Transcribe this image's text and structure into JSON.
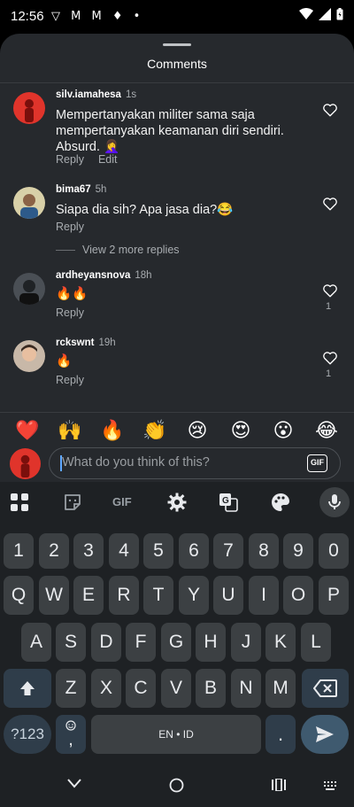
{
  "status_bar": {
    "time": "12:56",
    "notification_icons": "▽ M M ♦ •"
  },
  "sheet": {
    "title": "Comments"
  },
  "comments": [
    {
      "username": "silv.iamahesa",
      "time": "1s",
      "text": "Mempertanyakan militer sama saja mempertanyakan keamanan diri sendiri. Absurd. 🤦‍♀️",
      "actions": [
        "Reply",
        "Edit"
      ],
      "likes": ""
    },
    {
      "username": "bima67",
      "time": "5h",
      "text": "Siapa dia sih? Apa jasa dia?😂",
      "actions": [
        "Reply"
      ],
      "likes": "",
      "view_replies": "View 2 more replies"
    },
    {
      "username": "ardheyansnova",
      "time": "18h",
      "text": "🔥🔥",
      "actions": [
        "Reply"
      ],
      "likes": "1"
    },
    {
      "username": "rckswnt",
      "time": "19h",
      "text": "🔥",
      "actions": [
        "Reply"
      ],
      "likes": "1"
    }
  ],
  "emoji_bar": [
    "❤️",
    "🙌",
    "🔥",
    "👏",
    "😢",
    "😍",
    "😮",
    "😂"
  ],
  "comment_input": {
    "placeholder": "What do you think of this?",
    "gif_label": "GIF"
  },
  "keyboard": {
    "toolbar": [
      "apps-icon",
      "sticker-icon",
      "gif-icon",
      "settings-icon",
      "translate-icon",
      "palette-icon",
      "mic-icon"
    ],
    "toolbar_gif_label": "GIF",
    "row_numbers": [
      "1",
      "2",
      "3",
      "4",
      "5",
      "6",
      "7",
      "8",
      "9",
      "0"
    ],
    "row1": [
      "Q",
      "W",
      "E",
      "R",
      "T",
      "Y",
      "U",
      "I",
      "O",
      "P"
    ],
    "row2": [
      "A",
      "S",
      "D",
      "F",
      "G",
      "H",
      "J",
      "K",
      "L"
    ],
    "row3": [
      "Z",
      "X",
      "C",
      "V",
      "B",
      "N",
      "M"
    ],
    "symbols_key": "?123",
    "emoji_comma_key": ",",
    "space_label": "EN • ID",
    "period_key": "."
  },
  "colors": {
    "sheet_bg": "#26292d",
    "keyboard_bg": "#1e2124",
    "key_bg": "#3c4043",
    "accent_key_bg": "#2f3d4a",
    "cursor": "#5fa8ff"
  }
}
